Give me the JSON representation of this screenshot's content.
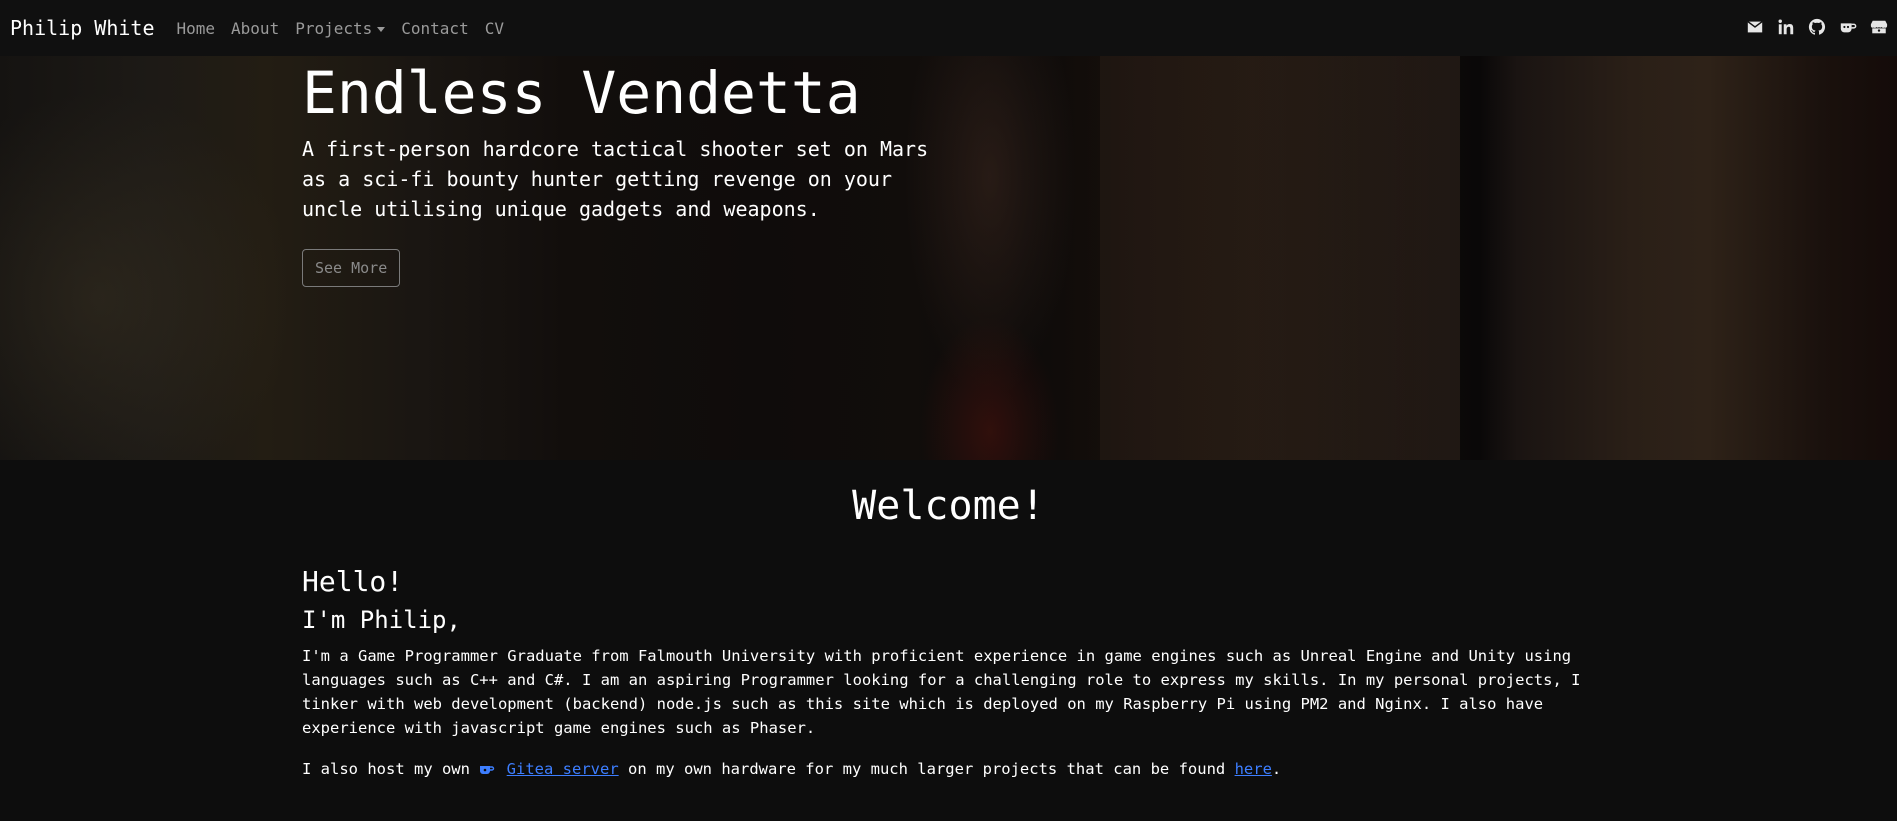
{
  "navbar": {
    "brand": "Philip White",
    "links": [
      {
        "label": "Home"
      },
      {
        "label": "About"
      },
      {
        "label": "Projects"
      },
      {
        "label": "Contact"
      },
      {
        "label": "CV"
      }
    ],
    "icons": [
      "envelope-icon",
      "linkedin-icon",
      "github-icon",
      "gitea-icon",
      "itchio-icon"
    ]
  },
  "hero": {
    "title": "Endless Vendetta",
    "subtitle": "A first-person hardcore tactical shooter set on Mars as a sci-fi bounty hunter getting revenge on your uncle utilising unique gadgets and weapons.",
    "button_label": "See More"
  },
  "main": {
    "welcome": "Welcome!",
    "hello": "Hello!",
    "intro": "I'm Philip,",
    "about": "I'm a Game Programmer Graduate from Falmouth University with proficient experience in game engines such as Unreal Engine and Unity using languages such as C++ and C#. I am an aspiring Programmer looking for a challenging role to express my skills. In my personal projects, I tinker with web development (backend) node.js such as this site which is deployed on my Raspberry Pi using PM2 and Nginx. I also have experience with javascript game engines such as Phaser.",
    "host_prefix": "I also host my own",
    "gitea_link": "Gitea server",
    "host_middle": "on my own hardware for my much larger projects that can be found",
    "here_link": "here",
    "host_suffix": "."
  },
  "colors": {
    "background": "#0d0d0d",
    "navbar": "#101010",
    "link": "#3d7eff",
    "nav_text": "#9a9a9a"
  }
}
